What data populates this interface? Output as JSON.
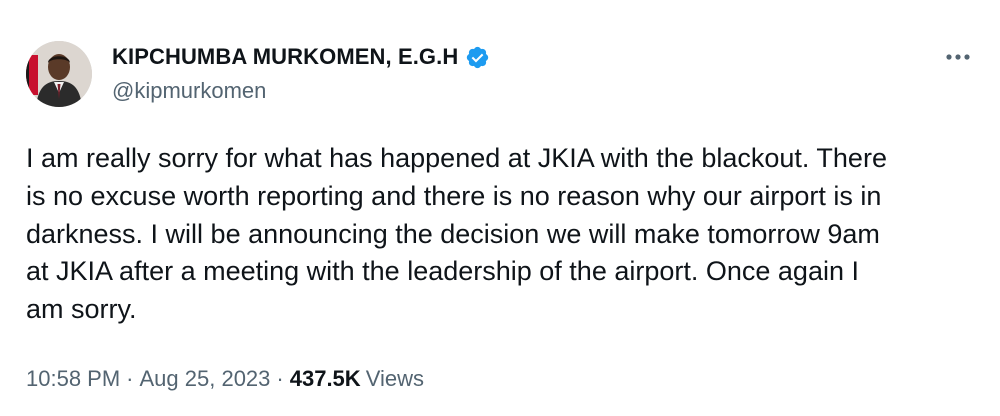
{
  "author": {
    "display_name": "KIPCHUMBA MURKOMEN, E.G.H",
    "handle": "@kipmurkomen",
    "verified": true,
    "avatar_icon": "profile-photo",
    "verified_icon": "verified-badge-icon",
    "verified_color": "#1d9bf0"
  },
  "menu": {
    "more_icon": "more-horizontal-icon"
  },
  "tweet": {
    "text": "I am really sorry for what has happened at JKIA with the blackout. There\nis no excuse worth reporting and there is no reason why our airport is in\ndarkness. I will be announcing the decision we will make  tomorrow 9am\nat JKIA after a meeting with the leadership of the airport.  Once again I\nam sorry."
  },
  "meta": {
    "time": "10:58 PM",
    "separator": "·",
    "date": "Aug 25, 2023",
    "views_count": "437.5K",
    "views_label": "Views"
  },
  "colors": {
    "text_primary": "#0f1419",
    "text_secondary": "#536471",
    "accent": "#1d9bf0"
  }
}
